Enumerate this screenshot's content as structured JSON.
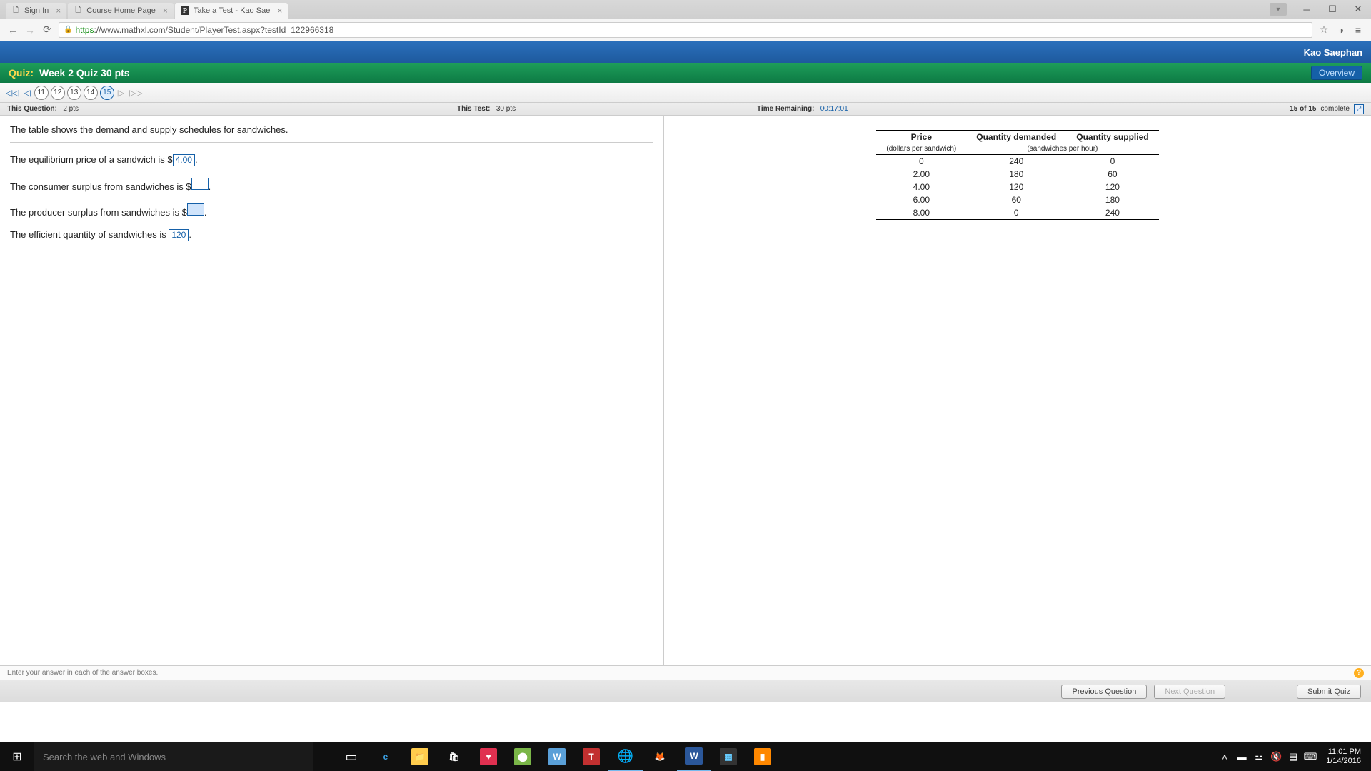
{
  "browser": {
    "tabs": [
      {
        "title": "Sign In",
        "active": false
      },
      {
        "title": "Course Home Page",
        "active": false
      },
      {
        "title": "Take a Test - Kao Sae",
        "active": true
      }
    ],
    "url_prefix": "https",
    "url_rest": "://www.mathxl.com/Student/PlayerTest.aspx?testId=122966318"
  },
  "header": {
    "username": "Kao Saephan",
    "quiz_label": "Quiz:",
    "quiz_name": "Week 2 Quiz 30 pts",
    "overview": "Overview"
  },
  "nav_questions": [
    "11",
    "12",
    "13",
    "14",
    "15"
  ],
  "status": {
    "this_q_label": "This Question:",
    "this_q_pts": "2 pts",
    "this_test_label": "This Test:",
    "this_test_pts": "30 pts",
    "time_label": "Time Remaining:",
    "time_val": "00:17:01",
    "progress": "15 of 15",
    "complete": "complete"
  },
  "question": {
    "prompt": "The table shows the demand and supply schedules for sandwiches.",
    "line1_a": "The equilibrium price of a sandwich is $",
    "ans1": "4.00",
    "line2_a": "The consumer surplus from sandwiches is $",
    "ans2": "",
    "line3_a": "The producer surplus from sandwiches is $",
    "ans3": "",
    "line4_a": "The efficient quantity of sandwiches is ",
    "ans4": "120",
    "period": "."
  },
  "table": {
    "h_price": "Price",
    "h_qd": "Quantity demanded",
    "h_qs": "Quantity supplied",
    "sub_price": "(dollars per sandwich)",
    "sub_qty": "(sandwiches per hour)",
    "rows": [
      {
        "p": "0",
        "qd": "240",
        "qs": "0"
      },
      {
        "p": "2.00",
        "qd": "180",
        "qs": "60"
      },
      {
        "p": "4.00",
        "qd": "120",
        "qs": "120"
      },
      {
        "p": "6.00",
        "qd": "60",
        "qs": "180"
      },
      {
        "p": "8.00",
        "qd": "0",
        "qs": "240"
      }
    ]
  },
  "footer": {
    "hint": "Enter your answer in each of the answer boxes.",
    "prev": "Previous Question",
    "next": "Next Question",
    "submit": "Submit Quiz"
  },
  "taskbar": {
    "search_placeholder": "Search the web and Windows",
    "time": "11:01 PM",
    "date": "1/14/2016"
  }
}
